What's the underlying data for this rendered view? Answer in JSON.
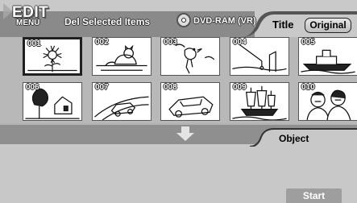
{
  "header": {
    "edit_title": "EDIT",
    "menu_label": "MENU",
    "mode_label": "Del Selected Items",
    "disc_label": "DVD-RAM (VR)",
    "title_tab": "Title",
    "original_tab": "Original"
  },
  "thumbnails": [
    {
      "number": "001",
      "icon": "sunflower-picture",
      "selected": true
    },
    {
      "number": "002",
      "icon": "cat-picture",
      "selected": false
    },
    {
      "number": "003",
      "icon": "bird-picture",
      "selected": false
    },
    {
      "number": "004",
      "icon": "fishing-picture",
      "selected": false
    },
    {
      "number": "005",
      "icon": "ship-picture",
      "selected": false
    },
    {
      "number": "006",
      "icon": "house-tree-picture",
      "selected": false
    },
    {
      "number": "007",
      "icon": "car-road-picture",
      "selected": false
    },
    {
      "number": "008",
      "icon": "car-picture",
      "selected": false
    },
    {
      "number": "009",
      "icon": "sailing-ship-picture",
      "selected": false
    },
    {
      "number": "010",
      "icon": "people-picture",
      "selected": false
    }
  ],
  "object_panel": {
    "tab_label": "Object",
    "start_label": "Start"
  },
  "colors": {
    "background": "#b3b3b3",
    "header_dark": "#8a8a8a",
    "band": "#8f8f8f",
    "panel": "#c8c8c8"
  }
}
